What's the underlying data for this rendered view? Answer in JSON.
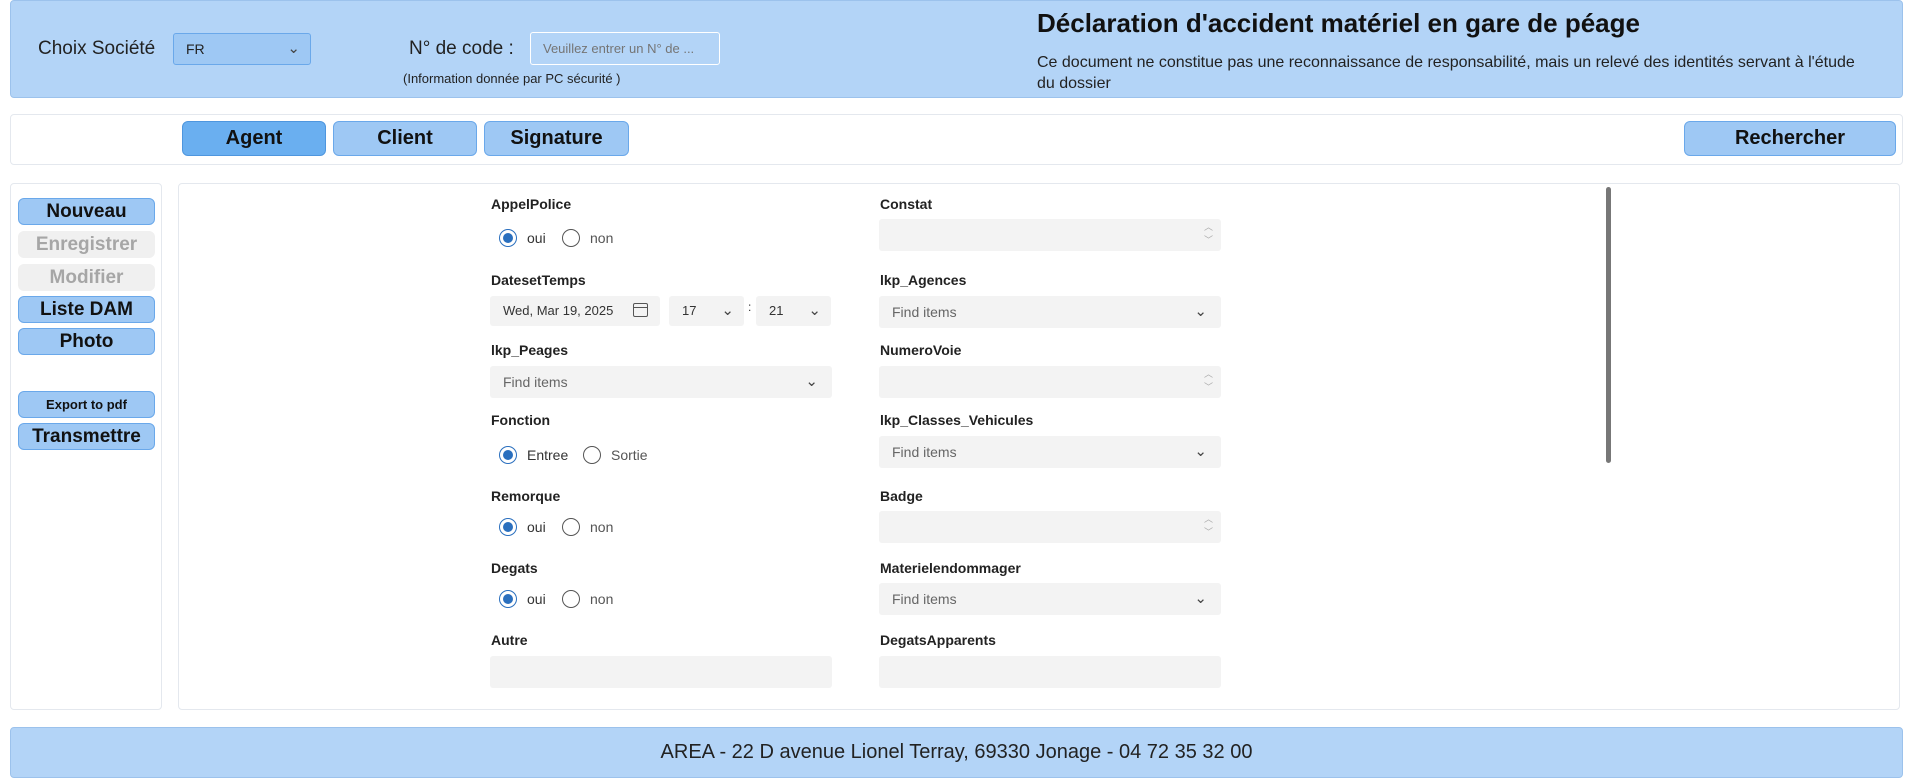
{
  "header": {
    "societe_label": "Choix Société",
    "societe_value": "FR",
    "code_label": "N° de code :",
    "code_placeholder": "Veuillez entrer un N° de ...",
    "code_note": "(Information donnée par PC sécurité )",
    "title": "Déclaration d'accident matériel en gare de péage",
    "subtitle": "Ce document ne constitue pas une reconnaissance de responsabilité, mais un relevé des identités servant à l'étude du dossier"
  },
  "tabs": {
    "agent": "Agent",
    "client": "Client",
    "signature": "Signature",
    "rechercher": "Rechercher",
    "active": "Agent"
  },
  "sidebar": {
    "nouveau": "Nouveau",
    "enregistrer": "Enregistrer",
    "modifier": "Modifier",
    "liste_dam": "Liste DAM",
    "photo": "Photo",
    "export_pdf": "Export to pdf",
    "transmettre": "Transmettre"
  },
  "form": {
    "appel_police": {
      "label": "AppelPolice",
      "opt1": "oui",
      "opt2": "non",
      "selected": "oui"
    },
    "constat": {
      "label": "Constat",
      "value": ""
    },
    "dateset_temps": {
      "label": "DatesetTemps",
      "date": "Wed, Mar 19, 2025",
      "hour": "17",
      "minute": "21",
      "separator": ":"
    },
    "agences": {
      "label": "lkp_Agences",
      "placeholder": "Find items"
    },
    "peages": {
      "label": "lkp_Peages",
      "placeholder": "Find items"
    },
    "numero_voie": {
      "label": "NumeroVoie",
      "value": ""
    },
    "fonction": {
      "label": "Fonction",
      "opt1": "Entree",
      "opt2": "Sortie",
      "selected": "Entree"
    },
    "classes_vehicules": {
      "label": "lkp_Classes_Vehicules",
      "placeholder": "Find items"
    },
    "remorque": {
      "label": "Remorque",
      "opt1": "oui",
      "opt2": "non",
      "selected": "oui"
    },
    "badge": {
      "label": "Badge",
      "value": ""
    },
    "degats": {
      "label": "Degats",
      "opt1": "oui",
      "opt2": "non",
      "selected": "oui"
    },
    "materiel_endommager": {
      "label": "Materielendommager",
      "placeholder": "Find items"
    },
    "autre": {
      "label": "Autre",
      "value": ""
    },
    "degats_apparents": {
      "label": "DegatsApparents",
      "value": ""
    }
  },
  "footer": {
    "text": "AREA - 22 D avenue Lionel Terray, 69330 Jonage - 04 72 35 32 00"
  },
  "icons": [
    "chevron-down-icon",
    "calendar-icon",
    "spinner-arrows-icon",
    "radio-icon"
  ],
  "colors": {
    "header_bg": "#b3d4f7",
    "button_bg": "#9ec8f4",
    "button_active_bg": "#6aaff0",
    "radio_selected": "#2a6fbe"
  }
}
